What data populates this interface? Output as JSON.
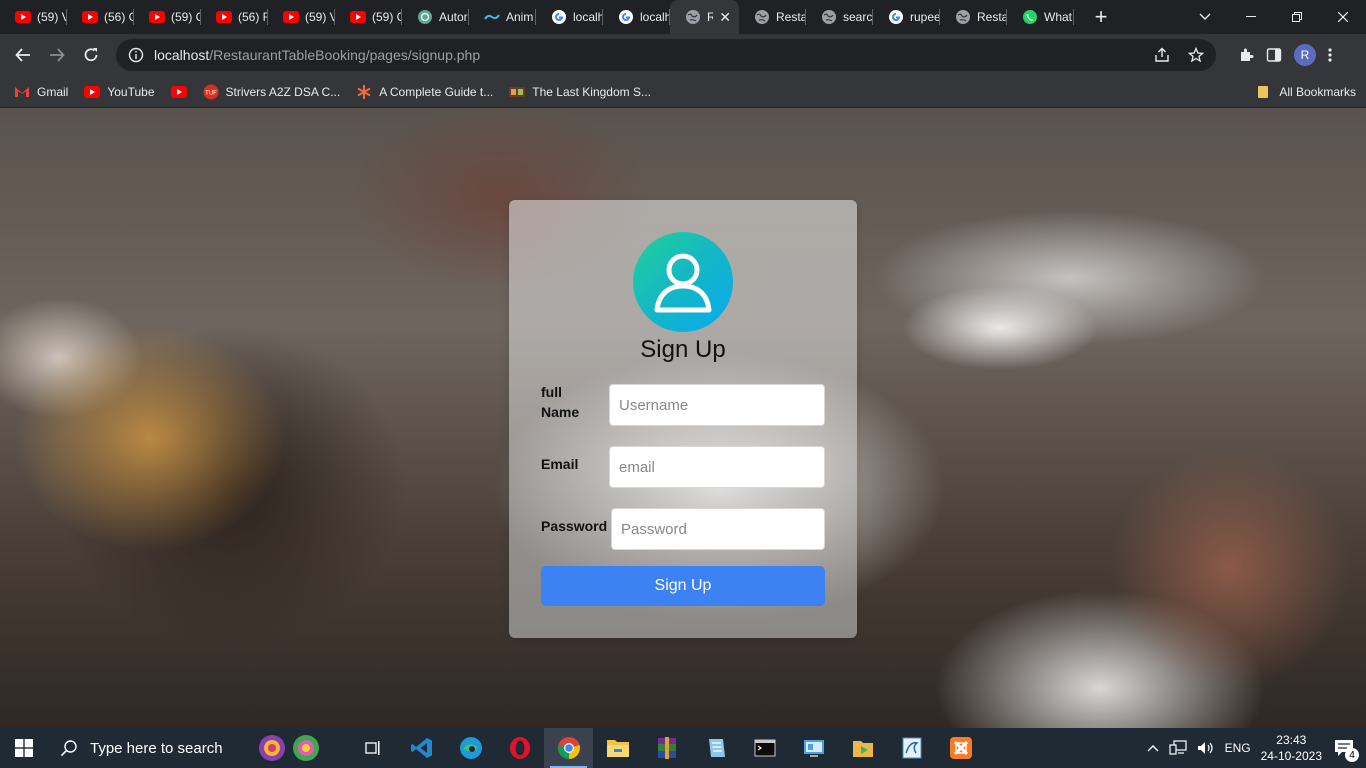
{
  "browser": {
    "tabs": [
      {
        "title": "(59) V",
        "favicon": "youtube-icon"
      },
      {
        "title": "(56) C",
        "favicon": "youtube-icon"
      },
      {
        "title": "(59) C",
        "favicon": "youtube-icon"
      },
      {
        "title": "(56) F",
        "favicon": "youtube-icon"
      },
      {
        "title": "(59) V",
        "favicon": "youtube-icon"
      },
      {
        "title": "(59) C",
        "favicon": "youtube-icon"
      },
      {
        "title": "Autor",
        "favicon": "chatgpt-icon"
      },
      {
        "title": "Anim",
        "favicon": "wave-icon"
      },
      {
        "title": "localh",
        "favicon": "google-icon"
      },
      {
        "title": "localh",
        "favicon": "google-icon"
      },
      {
        "title": "R",
        "favicon": "globe-icon",
        "active": true
      },
      {
        "title": "Resta",
        "favicon": "globe-icon"
      },
      {
        "title": "searc",
        "favicon": "globe-icon"
      },
      {
        "title": "rupee",
        "favicon": "google-icon"
      },
      {
        "title": "Resta",
        "favicon": "globe-icon"
      },
      {
        "title": "What",
        "favicon": "whatsapp-icon"
      }
    ],
    "url_host": "localhost",
    "url_path": "/RestaurantTableBooking/pages/signup.php",
    "profile_initial": "R",
    "bookmarks": [
      {
        "label": "Gmail",
        "icon": "gmail-icon"
      },
      {
        "label": "YouTube",
        "icon": "youtube-icon"
      },
      {
        "label": "",
        "icon": "youtube-icon"
      },
      {
        "label": "Strivers A2Z DSA C...",
        "icon": "tuf-icon"
      },
      {
        "label": "A Complete Guide t...",
        "icon": "asterisk-icon"
      },
      {
        "label": "The Last Kingdom S...",
        "icon": "film-icon"
      }
    ],
    "all_bookmarks_label": "All Bookmarks"
  },
  "signup": {
    "title": "Sign Up",
    "fullname_label": "full Name",
    "fullname_placeholder": "Username",
    "email_label": "Email",
    "email_placeholder": "email",
    "password_label": "Password",
    "password_placeholder": "Password",
    "button_label": "Sign Up"
  },
  "taskbar": {
    "search_placeholder": "Type here to search",
    "language": "ENG",
    "time": "23:43",
    "date": "24-10-2023",
    "notification_count": "4",
    "apps": [
      "task-view-icon",
      "vscode-icon",
      "edge-icon",
      "opera-icon",
      "chrome-icon",
      "file-explorer-icon",
      "winrar-icon",
      "notepad-icon",
      "terminal-icon",
      "control-panel-icon",
      "file-manager-icon",
      "mysql-icon",
      "xampp-icon"
    ]
  },
  "colors": {
    "accent": "#3d82f5",
    "avatar_gradient_start": "#22d197",
    "avatar_gradient_end": "#0aa8f0",
    "taskbar": "#1f2a35"
  }
}
